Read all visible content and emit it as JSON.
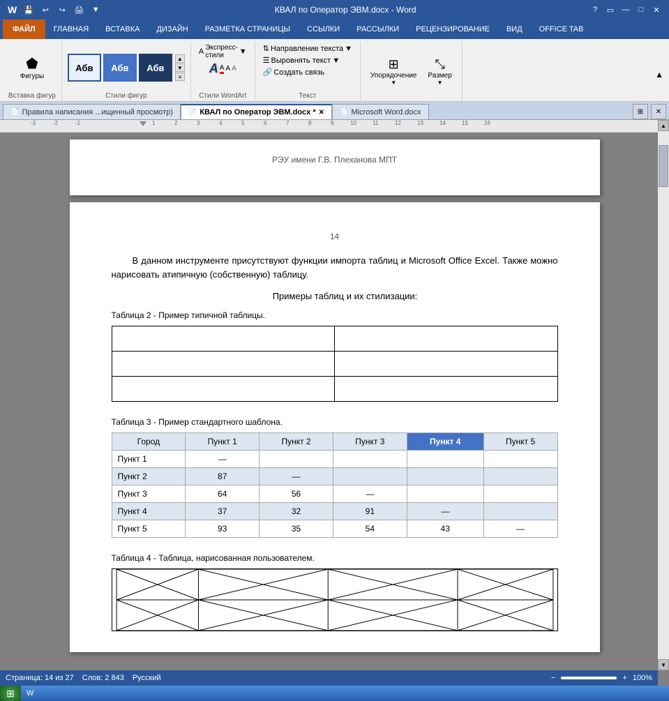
{
  "titlebar": {
    "title": "КВАЛ по Оператор ЭВМ.docx - Word",
    "help_btn": "?",
    "min_btn": "—",
    "max_btn": "□",
    "close_btn": "✕"
  },
  "ribbon": {
    "tabs": [
      {
        "id": "file",
        "label": "ФАЙЛ",
        "type": "file"
      },
      {
        "id": "main",
        "label": "ГЛАВНАЯ",
        "active": false
      },
      {
        "id": "insert",
        "label": "ВСТАВКА",
        "active": false
      },
      {
        "id": "design",
        "label": "ДИЗАЙН",
        "active": false
      },
      {
        "id": "pagelayout",
        "label": "РАЗМЕТКА СТРАНИЦЫ",
        "active": false
      },
      {
        "id": "links",
        "label": "ССЫЛКИ",
        "active": false
      },
      {
        "id": "mailings",
        "label": "РАССЫЛКИ",
        "active": false
      },
      {
        "id": "review",
        "label": "РЕЦЕНЗИРОВАНИЕ",
        "active": false
      },
      {
        "id": "view",
        "label": "ВИД",
        "active": false
      },
      {
        "id": "officetab",
        "label": "OFFICE TAB",
        "active": false
      }
    ],
    "active_tab": "insert",
    "groups": {
      "insert_shapes": {
        "label": "Вставка фигур",
        "shapes_label": "Фигуры"
      },
      "style_shapes": {
        "label": "Стили фигур",
        "styles": [
          "Абв",
          "Абв",
          "Абв"
        ]
      },
      "express_styles": {
        "label": "Стили WordArt",
        "express_label": "Экспресс-стили"
      },
      "text_group": {
        "label": "Текст",
        "direction_btn": "Направление текста",
        "align_btn": "Выровнять текст",
        "link_btn": "Создать связь"
      },
      "arrange_group": {
        "label": "",
        "order_btn": "Упорядочение",
        "size_btn": "Размер"
      }
    }
  },
  "doc_tabs": {
    "tabs": [
      {
        "id": "rules",
        "label": "Правила написания ...ищенный просмотр)",
        "active": false
      },
      {
        "id": "kval",
        "label": "КВАЛ по Оператор ЭВМ.docx",
        "active": true,
        "modified": true
      },
      {
        "id": "msword",
        "label": "Microsoft Word.docx",
        "active": false
      }
    ]
  },
  "document": {
    "page1": {
      "header_text": "РЭУ имени Г.В. Плеханова МПТ"
    },
    "page2": {
      "page_number": "14",
      "paragraph1": "В данном инструменте присутствуют функции импорта таблиц и Microsoft Office Excel. Также можно нарисовать атипичную (собственную) таблицу.",
      "subheading": "Примеры таблиц и их стилизации:",
      "table2_caption": "Таблица 2 - Пример типичной таблицы.",
      "table3_caption": "Таблица 3 - Пример стандартного шаблона.",
      "table3": {
        "headers": [
          "Город",
          "Пункт 1",
          "Пункт 2",
          "Пункт 3",
          "Пункт 4",
          "Пункт 5"
        ],
        "highlighted_col": 4,
        "rows": [
          [
            "Пункт 1",
            "—",
            "",
            "",
            "",
            ""
          ],
          [
            "Пункт 2",
            "87",
            "—",
            "",
            "",
            ""
          ],
          [
            "Пункт 3",
            "64",
            "56",
            "—",
            "",
            ""
          ],
          [
            "Пункт 4",
            "37",
            "32",
            "91",
            "—",
            ""
          ],
          [
            "Пункт 5",
            "93",
            "35",
            "54",
            "43",
            "—"
          ]
        ]
      },
      "table4_caption": "Таблица 4 - Таблица, нарисованная пользователем."
    }
  },
  "statusbar": {
    "page_info": "Страница: 14 из 27",
    "word_count": "Слов: 2 843",
    "language": "Русский",
    "zoom": "100%"
  }
}
